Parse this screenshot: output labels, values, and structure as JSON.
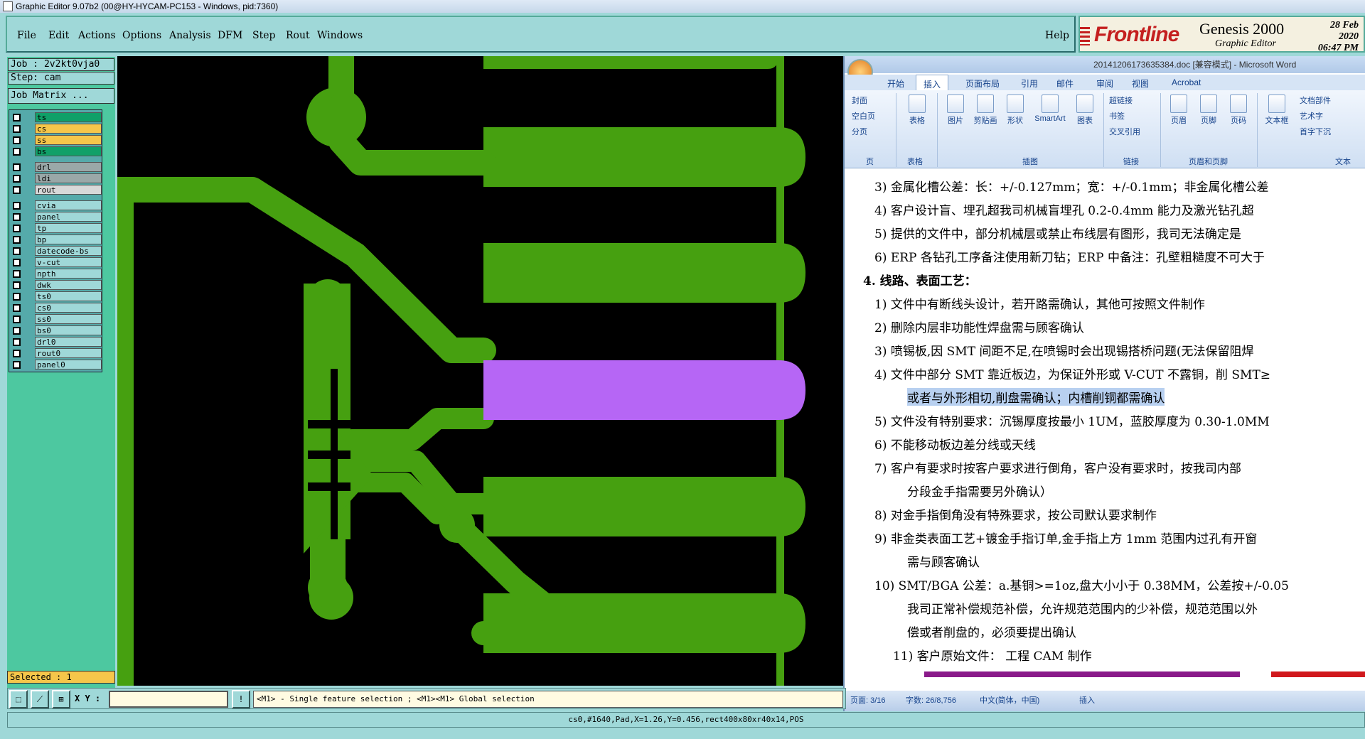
{
  "window_title": "Graphic Editor 9.07b2 (00@HY-HYCAM-PC153 - Windows, pid:7360)",
  "menu": [
    "File",
    "Edit",
    "Actions",
    "Options",
    "Analysis",
    "DFM",
    "Step",
    "Rout",
    "Windows"
  ],
  "help_label": "Help",
  "logo": {
    "brand": "Frontline",
    "product": "Genesis 2000",
    "subtitle": "Graphic Editor",
    "date": "28 Feb 2020",
    "time": "06:47 PM"
  },
  "job": {
    "job_line": "Job : 2v2kt0vja0",
    "step_line": "Step: cam",
    "matrix_button": "Job Matrix ..."
  },
  "layers": [
    {
      "name": "ts",
      "color": "#10a068"
    },
    {
      "name": "cs",
      "color": "#f6c64a"
    },
    {
      "name": "ss",
      "color": "#f6c64a"
    },
    {
      "name": "bs",
      "color": "#10a068"
    },
    {
      "name": "drl",
      "color": "#9aa8a8"
    },
    {
      "name": "ldi",
      "color": "#9aa8a8"
    },
    {
      "name": "rout",
      "color": "#d8d8d8"
    },
    {
      "name": "cvia",
      "color": "#9fd8d8"
    },
    {
      "name": "panel",
      "color": "#9fd8d8"
    },
    {
      "name": "tp",
      "color": "#9fd8d8"
    },
    {
      "name": "bp",
      "color": "#9fd8d8"
    },
    {
      "name": "datecode-bs",
      "color": "#9fd8d8"
    },
    {
      "name": "v-cut",
      "color": "#9fd8d8"
    },
    {
      "name": "npth",
      "color": "#9fd8d8"
    },
    {
      "name": "dwk",
      "color": "#9fd8d8"
    },
    {
      "name": "ts0",
      "color": "#9fd8d8"
    },
    {
      "name": "cs0",
      "color": "#9fd8d8"
    },
    {
      "name": "ss0",
      "color": "#9fd8d8"
    },
    {
      "name": "bs0",
      "color": "#9fd8d8"
    },
    {
      "name": "drl0",
      "color": "#9fd8d8"
    },
    {
      "name": "rout0",
      "color": "#9fd8d8"
    },
    {
      "name": "panel0",
      "color": "#9fd8d8"
    }
  ],
  "selected_text": "Selected : 1",
  "xy_label": "X Y :",
  "xy_value": "",
  "hint": "<M1> - Single feature selection ; <M1><M1> Global selection",
  "status_line": "cs0,#1640,Pad,X=1.26,Y=0.456,rect400x80xr40x14,POS",
  "colors": {
    "copper": "#46a010",
    "highlight": "#b666f5",
    "background": "#000000"
  },
  "word": {
    "doc_title": "20141206173635384.doc [兼容模式] - Microsoft Word",
    "tabs": [
      "开始",
      "插入",
      "页面布局",
      "引用",
      "邮件",
      "审阅",
      "视图",
      "Acrobat"
    ],
    "active_tab": "插入",
    "ribbon_buttons": [
      "封面",
      "空白页",
      "分页",
      "表格",
      "图片",
      "剪贴画",
      "形状",
      "SmartArt",
      "图表",
      "超链接",
      "书签",
      "交叉引用",
      "页眉",
      "页脚",
      "页码",
      "文本框",
      "文档部件",
      "艺术字",
      "首字下沉"
    ],
    "ribbon_groups": [
      "页",
      "表格",
      "插图",
      "链接",
      "页眉和页脚",
      "文本"
    ],
    "lines": [
      "3)  金属化槽公差：长：+/-0.127mm；宽：+/-0.1mm；非金属化槽公差",
      "4)  客户设计盲、埋孔超我司机械盲埋孔 0.2-0.4mm 能力及激光钻孔超",
      "5)  提供的文件中，部分机械层或禁止布线层有图形，我司无法确定是",
      "6)  ERP 各钻孔工序备注使用新刀钻；ERP 中备注：孔壁粗糙度不可大于",
      "4.  线路、表面工艺：",
      "1)  文件中有断线头设计，若开路需确认，其他可按照文件制作",
      "2)  删除内层非功能性焊盘需与顾客确认",
      "3)  喷锡板,因 SMT 间距不足,在喷锡时会出现锡搭桥问题(无法保留阻焊",
      "4)  文件中部分 SMT 靠近板边，为保证外形或 V-CUT 不露铜，削 SMT≥",
      "或者与外形相切,削盘需确认；内槽削铜都需确认",
      "5)  文件没有特别要求：沉锡厚度按最小 1UM，蓝胶厚度为 0.30-1.0MM",
      "6)  不能移动板边差分线或天线",
      "7)  客户有要求时按客户要求进行倒角，客户没有要求时，按我司内部",
      "分段金手指需要另外确认）",
      "8)  对金手指倒角没有特殊要求，按公司默认要求制作",
      "9)  非金类表面工艺+镀金手指订单,金手指上方 1mm 范围内过孔有开窗",
      "需与顾客确认",
      "10) SMT/BGA 公差：a.基铜>=1oz,盘大小小于 0.38MM，公差按+/-0.05",
      "我司正常补偿规范补偿，允许规范范围内的少补偿，规范范围以外",
      "偿或者削盘的，必须要提出确认",
      "11)          客户原始文件：                    工程 CAM 制作"
    ],
    "status": [
      "页面: 3/16",
      "字数: 26/8,756",
      "中文(简体，中国)",
      "插入"
    ]
  }
}
